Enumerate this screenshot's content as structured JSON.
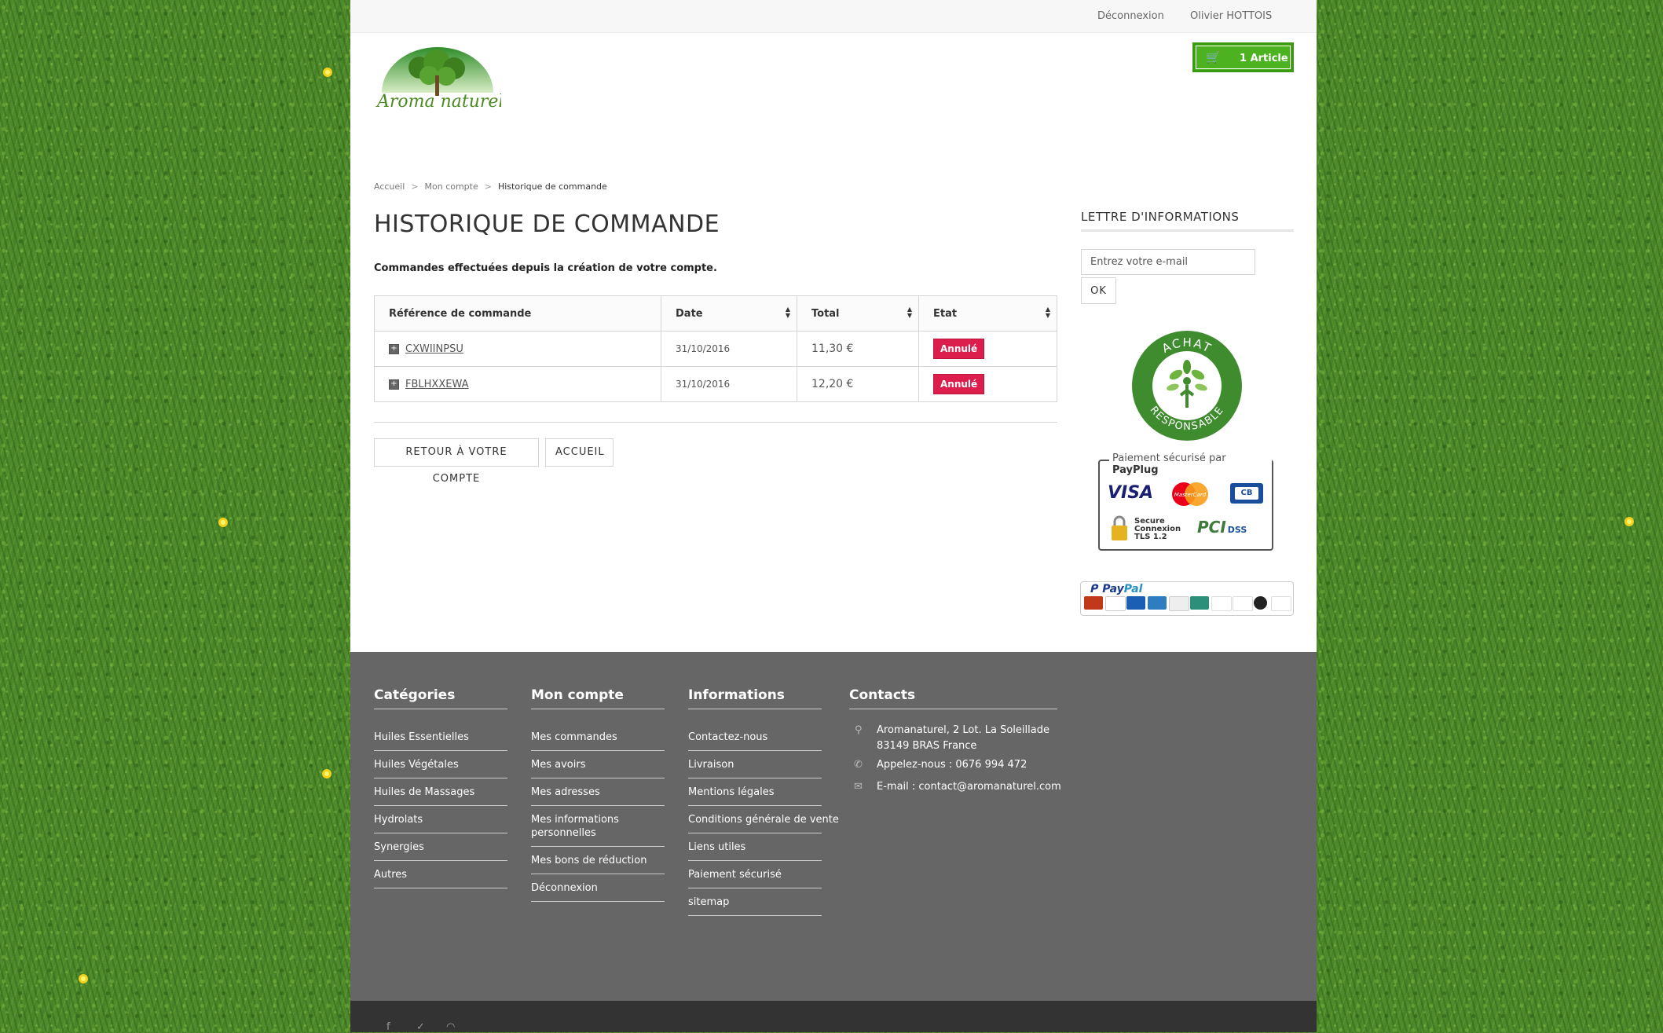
{
  "topbar": {
    "logout": "Déconnexion",
    "user": "Olivier HOTTOIS"
  },
  "header": {
    "logo_text": "Aroma naturel",
    "cart_label": "1 Article",
    "cart_icon": "cart-icon",
    "brand_color": "#4cb21f"
  },
  "breadcrumb": {
    "home": "Accueil",
    "sep": ">",
    "account": "Mon compte",
    "current": "Historique de commande"
  },
  "main": {
    "title": "HISTORIQUE DE COMMANDE",
    "intro": "Commandes effectuées depuis la création de votre compte.",
    "table": {
      "headers": [
        "Référence de commande",
        "Date",
        "Total",
        "Etat"
      ],
      "rows": [
        {
          "ref": "CXWIINPSU",
          "date": "31/10/2016",
          "total": "11,30 €",
          "state": "Annulé"
        },
        {
          "ref": "FBLHXXEWA",
          "date": "31/10/2016",
          "total": "12,20 €",
          "state": "Annulé"
        }
      ]
    },
    "back_button": "RETOUR À VOTRE COMPTE",
    "home_button": "ACCUEIL"
  },
  "sidebar": {
    "newsletter_title": "LETTRE D'INFORMATIONS",
    "newsletter_placeholder": "Entrez votre e-mail",
    "ok": "OK",
    "badge_top": "ACHAT",
    "badge_bottom": "RESPONSABLE",
    "payplug_prefix": "Paiement sécurisé par",
    "payplug_brand": "PayPlug",
    "visa": "VISA",
    "mastercard": "MasterCard",
    "cb": "CB",
    "secure_lines": [
      "Secure",
      "Connexion",
      "TLS 1.2"
    ],
    "pci": "PCI",
    "dss": "DSS",
    "paypal_pay": "Pay",
    "paypal_pal": "Pal"
  },
  "footer": {
    "categories": {
      "title": "Catégories",
      "items": [
        "Huiles Essentielles",
        "Huiles Végétales",
        "Huiles de Massages",
        "Hydrolats",
        "Synergies",
        "Autres"
      ]
    },
    "account": {
      "title": "Mon compte",
      "items": [
        "Mes commandes",
        "Mes avoirs",
        "Mes adresses",
        "Mes informations personnelles",
        "Mes bons de réduction",
        "Déconnexion"
      ]
    },
    "info": {
      "title": "Informations",
      "items": [
        "Contactez-nous",
        "Livraison",
        "Mentions légales",
        "Conditions générale de vente",
        "Liens utiles",
        "Paiement sécurisé",
        "sitemap"
      ]
    },
    "contacts": {
      "title": "Contacts",
      "address_line1": "Aromanaturel, 2 Lot. La Soleillade",
      "address_line2": "83149 BRAS France",
      "phone": "Appelez-nous : 0676 994 472",
      "email": "E-mail : contact@aromanaturel.com"
    }
  }
}
